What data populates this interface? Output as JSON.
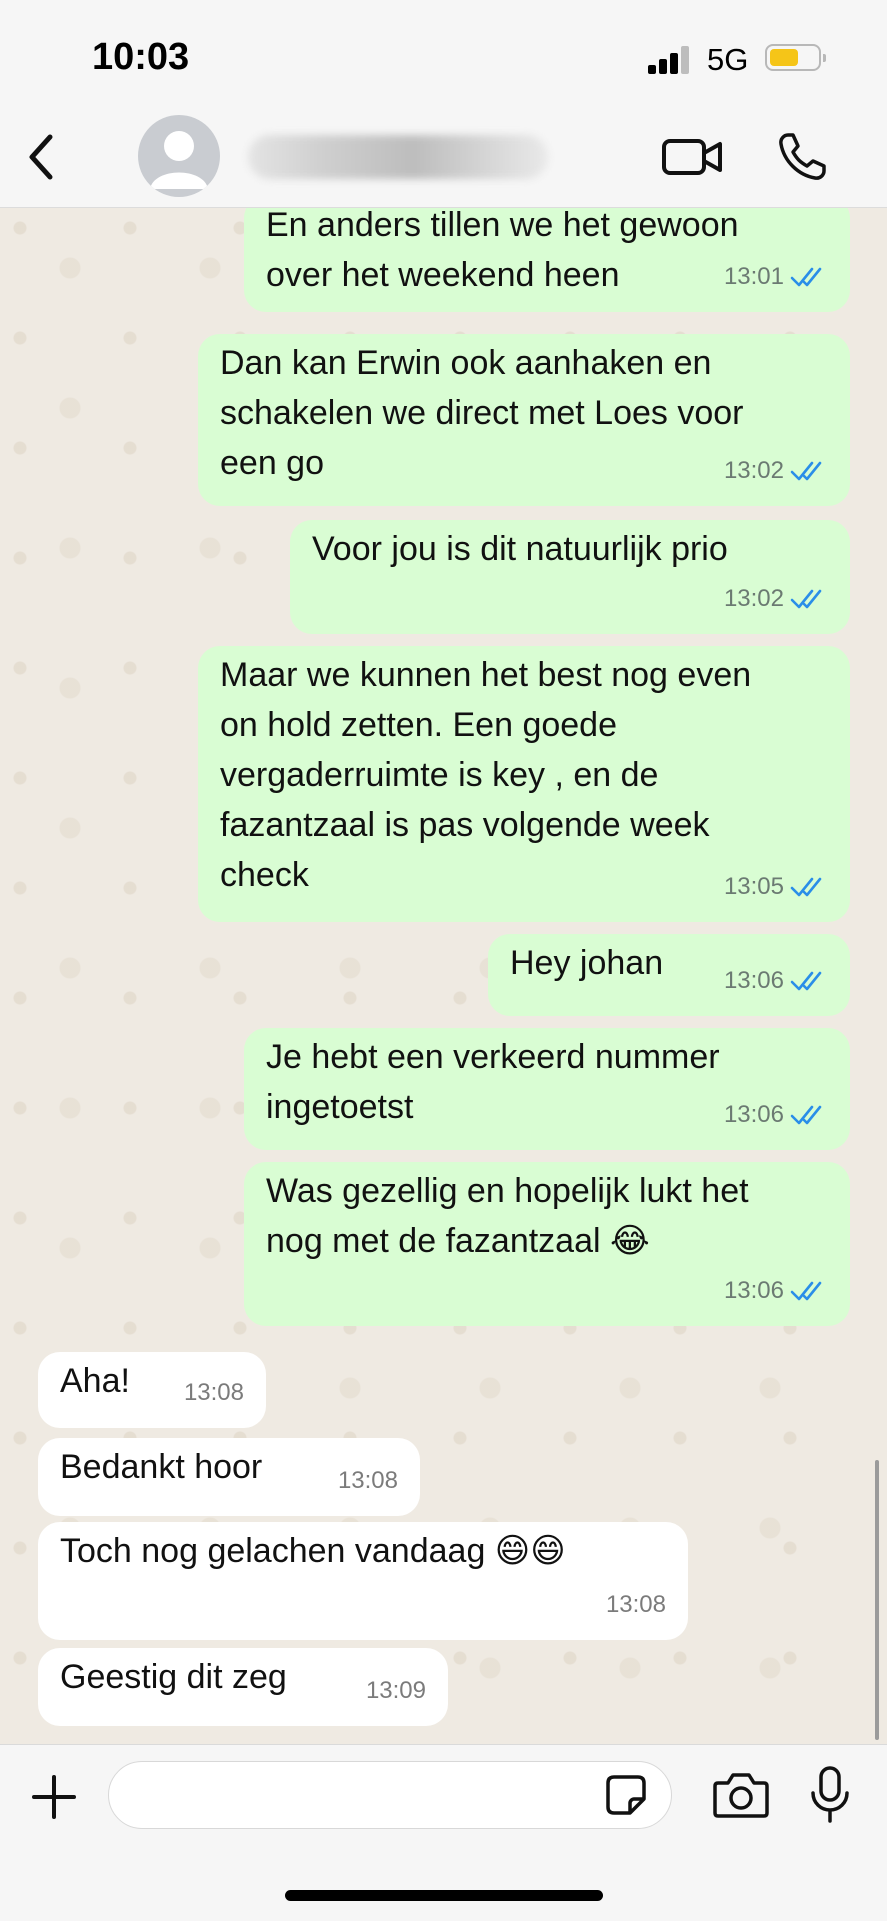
{
  "status_bar": {
    "time": "10:03",
    "network": "5G"
  },
  "messages": [
    {
      "dir": "out",
      "text": "En anders tillen we het gewoon\nover het weekend heen",
      "time": "13:01"
    },
    {
      "dir": "out",
      "text": "Dan kan Erwin ook aanhaken en\nschakelen we direct met Loes voor\neen go",
      "time": "13:02"
    },
    {
      "dir": "out",
      "text": "Voor jou is dit natuurlijk prio",
      "time": "13:02"
    },
    {
      "dir": "out",
      "text": "Maar we kunnen het best nog even\non hold zetten. Een goede\nvergaderruimte is key , en de\nfazantzaal is pas volgende week\ncheck",
      "time": "13:05"
    },
    {
      "dir": "out",
      "text": "Hey johan",
      "time": "13:06"
    },
    {
      "dir": "out",
      "text": "Je hebt een verkeerd nummer\ningetoetst",
      "time": "13:06"
    },
    {
      "dir": "out",
      "text": "Was gezellig en hopelijk lukt het\nnog met de fazantzaal 😂",
      "time": "13:06"
    },
    {
      "dir": "in",
      "text": "Aha!",
      "time": "13:08"
    },
    {
      "dir": "in",
      "text": "Bedankt hoor",
      "time": "13:08"
    },
    {
      "dir": "in",
      "text": "Toch nog gelachen vandaag 😄😄",
      "time": "13:08"
    },
    {
      "dir": "in",
      "text": "Geestig dit zeg",
      "time": "13:09"
    }
  ],
  "icons": {
    "back": "chevron-left-icon",
    "avatar": "person-avatar-icon",
    "video": "video-camera-icon",
    "call": "phone-icon",
    "attach": "plus-icon",
    "sticker": "sticker-icon",
    "camera": "camera-icon",
    "mic": "microphone-icon"
  },
  "colors": {
    "outgoing_bubble": "#d9fdd3",
    "incoming_bubble": "#ffffff",
    "read_ticks": "#2a8ee8",
    "battery": "#f5c518"
  }
}
